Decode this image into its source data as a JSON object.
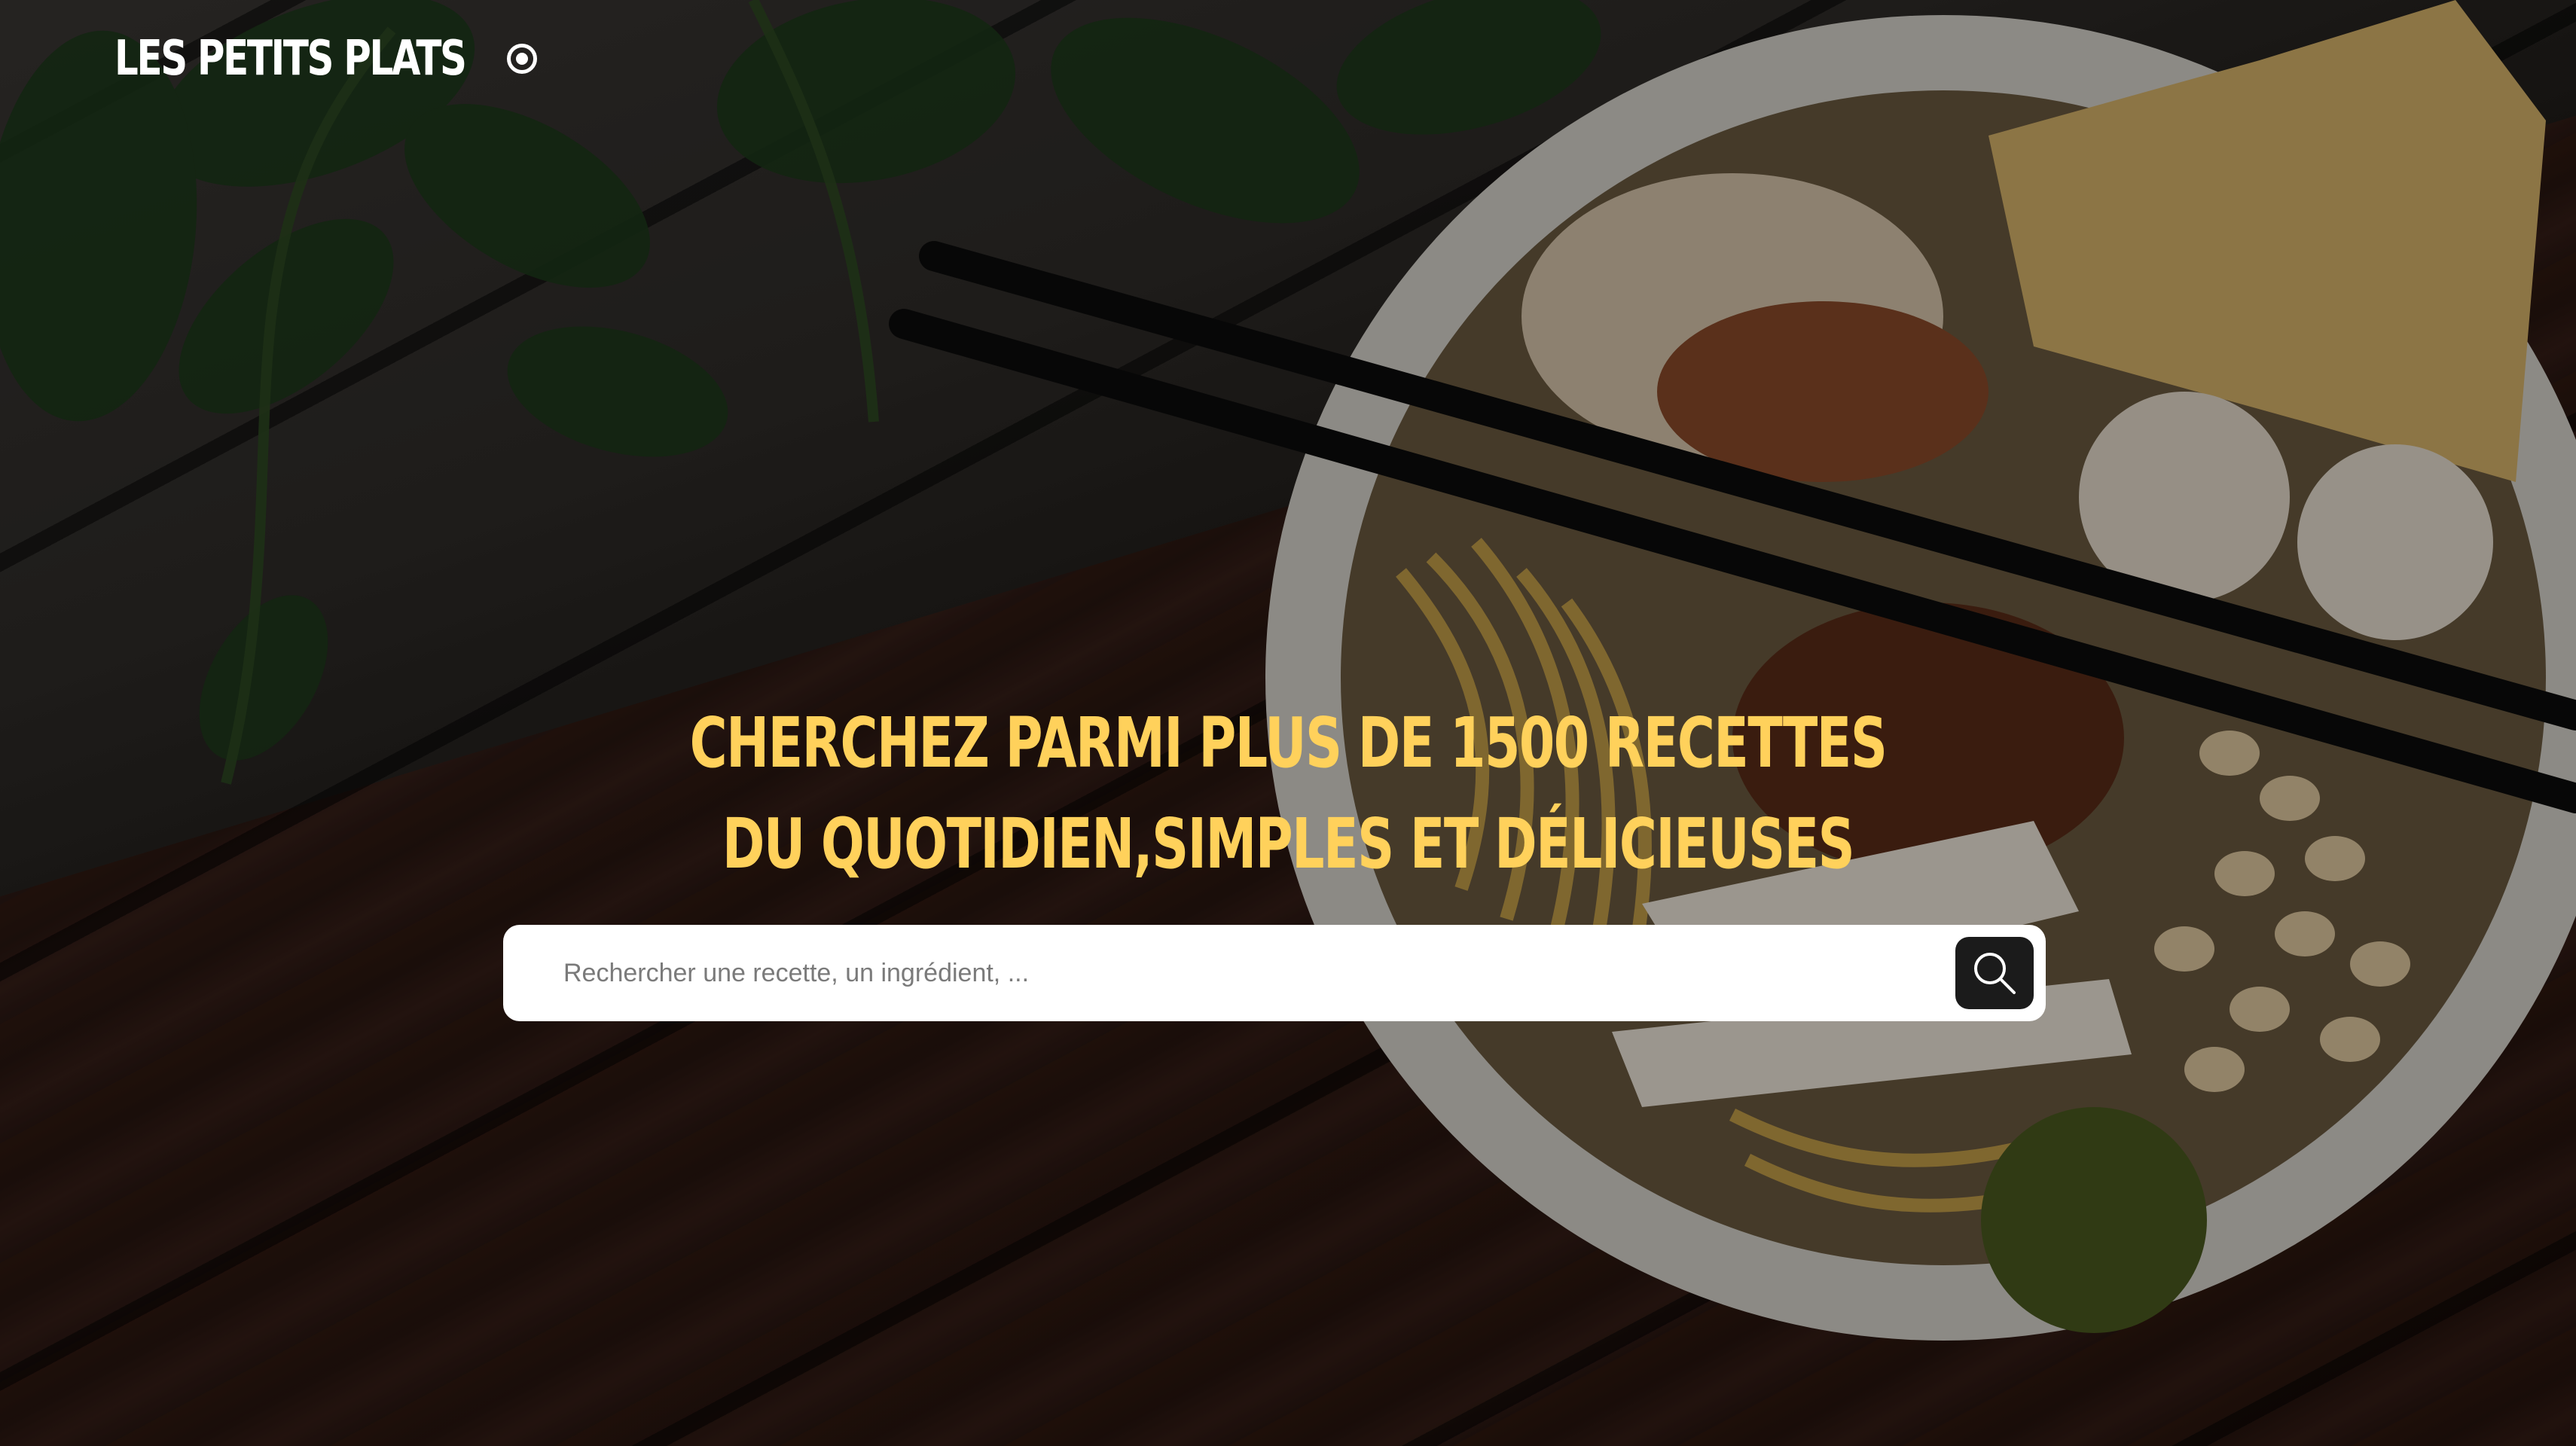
{
  "header": {
    "logo_text": "LES PETITS PLATS",
    "logo_icon": "record-circle-icon"
  },
  "hero": {
    "headline_line1": "CHERCHEZ PARMI PLUS DE 1500 RECETTES",
    "headline_line2": "DU QUOTIDIEN,SIMPLES ET DÉLICIEUSES",
    "background_image": "bowl-of-noodles-with-chopsticks-photo"
  },
  "search": {
    "placeholder": "Rechercher une recette, un ingrédient, ...",
    "value": "",
    "button_icon": "magnifier-icon"
  },
  "colors": {
    "accent": "#FFD15B",
    "search_button": "#1B1B1B",
    "logo": "#FFFFFF"
  }
}
